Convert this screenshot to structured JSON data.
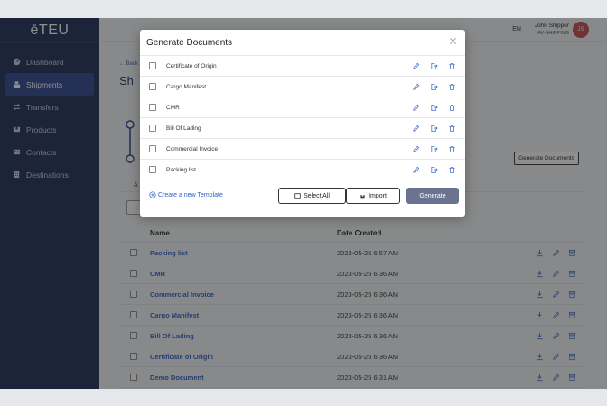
{
  "app": {
    "logo": "ēTEU"
  },
  "sidebar": {
    "items": [
      {
        "label": "Dashboard",
        "icon": "dashboard-icon"
      },
      {
        "label": "Shipments",
        "icon": "shipments-icon",
        "active": true
      },
      {
        "label": "Transfers",
        "icon": "transfers-icon"
      },
      {
        "label": "Products",
        "icon": "products-icon"
      },
      {
        "label": "Contacts",
        "icon": "contacts-icon"
      },
      {
        "label": "Destinations",
        "icon": "destinations-icon"
      }
    ]
  },
  "header": {
    "lang": "EN",
    "user_name": "John Shipper",
    "company": "AV-SHIPPING",
    "avatar_initials": "JS"
  },
  "page": {
    "back": "← Back",
    "title_fragment": "Sh",
    "generate_button": "Generate Documents",
    "tab_fragment": "A"
  },
  "table": {
    "columns": {
      "name": "Name",
      "date": "Date Created"
    },
    "rows": [
      {
        "name": "Packing list",
        "date": "2023-05-25 6:57 AM"
      },
      {
        "name": "CMR",
        "date": "2023-05-25 6:36 AM"
      },
      {
        "name": "Commercial Invoice",
        "date": "2023-05-25 6:36 AM"
      },
      {
        "name": "Cargo Manifest",
        "date": "2023-05-25 6:36 AM"
      },
      {
        "name": "Bill Of Lading",
        "date": "2023-05-25 6:36 AM"
      },
      {
        "name": "Certificate of Origin",
        "date": "2023-05-25 6:36 AM"
      },
      {
        "name": "Demo Document",
        "date": "2023-05-25 6:31 AM"
      }
    ]
  },
  "modal": {
    "title": "Generate Documents",
    "templates": [
      "Certificate of Origin",
      "Cargo Manifest",
      "CMR",
      "Bill Of Lading",
      "Commercial Invoice",
      "Packing list"
    ],
    "create_link": "Create a new Template",
    "select_all": "Select All",
    "import": "Import",
    "generate": "Generate"
  },
  "colors": {
    "sidebar": "#1a2a57",
    "active": "#2c4390",
    "link": "#2c5fc4",
    "primary_button": "#6a7490",
    "icon": "#4a72c8"
  }
}
